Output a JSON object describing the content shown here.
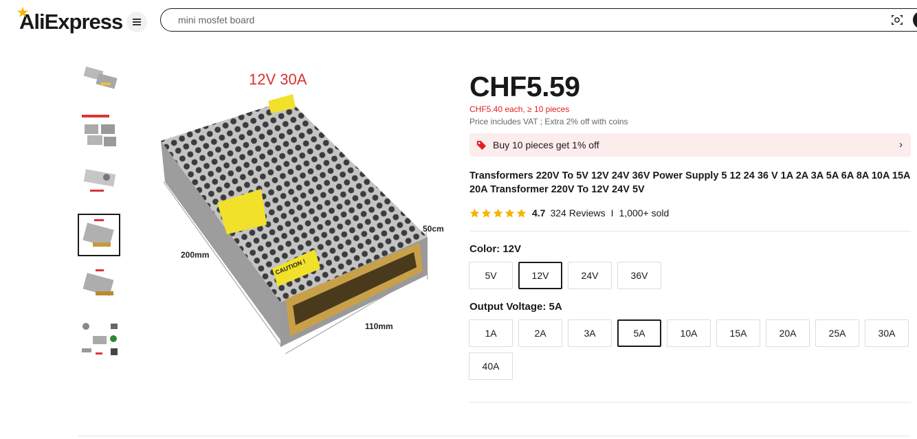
{
  "header": {
    "logo_text": "AliExpress",
    "search_value": "mini mosfet board"
  },
  "gallery": {
    "thumbnail_count": 6,
    "selected_index": 3,
    "main_image_label": "12V  30A",
    "dim_width": "200mm",
    "dim_depth": "110mm",
    "dim_height": "50cm",
    "caution_label": "CAUTION !"
  },
  "product": {
    "price": "CHF5.59",
    "bulk_price": "CHF5.40 each, ≥ 10 pieces",
    "vat_note": "Price includes VAT ; Extra 2% off with coins",
    "promo": "Buy 10 pieces get 1% off",
    "title": "Transformers 220V To 5V 12V 24V 36V Power Supply 5 12 24 36 V 1A 2A 3A 5A 6A 8A 10A 15A 20A Transformer 220V To 12V 24V 5V",
    "rating": "4.7",
    "reviews": "324 Reviews",
    "separator": "I",
    "sold": "1,000+ sold"
  },
  "color_option": {
    "label": "Color: ",
    "selected": "12V",
    "values": [
      "5V",
      "12V",
      "24V",
      "36V"
    ]
  },
  "voltage_option": {
    "label": "Output Voltage: ",
    "selected": "5A",
    "values": [
      "1A",
      "2A",
      "3A",
      "5A",
      "10A",
      "15A",
      "20A",
      "25A",
      "30A",
      "40A"
    ]
  },
  "colors": {
    "price_red": "#e02020",
    "promo_bg": "#fdecec",
    "star_yellow": "#f7b500"
  }
}
